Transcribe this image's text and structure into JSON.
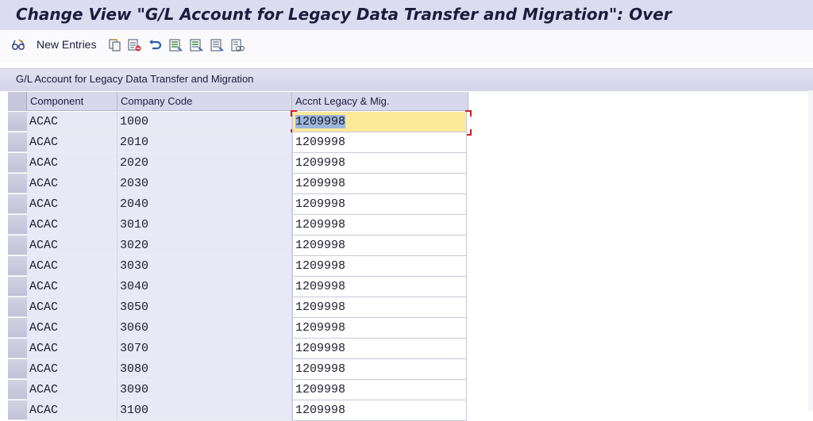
{
  "window": {
    "title": "Change View \"G/L Account for Legacy Data Transfer and Migration\": Over"
  },
  "toolbar": {
    "new_entries_label": "New Entries",
    "icons": [
      "glasses-icon",
      "copy-icon",
      "delete-icon",
      "undo-icon",
      "select-all-icon",
      "select-block-icon",
      "deselect-all-icon",
      "print-icon"
    ]
  },
  "panel": {
    "title": "G/L Account for Legacy Data Transfer and Migration",
    "columns": [
      "Component",
      "Company Code",
      "Accnt Legacy & Mig."
    ],
    "rows": [
      {
        "component": "ACAC",
        "company_code": "1000",
        "account": "1209998"
      },
      {
        "component": "ACAC",
        "company_code": "2010",
        "account": "1209998"
      },
      {
        "component": "ACAC",
        "company_code": "2020",
        "account": "1209998"
      },
      {
        "component": "ACAC",
        "company_code": "2030",
        "account": "1209998"
      },
      {
        "component": "ACAC",
        "company_code": "2040",
        "account": "1209998"
      },
      {
        "component": "ACAC",
        "company_code": "3010",
        "account": "1209998"
      },
      {
        "component": "ACAC",
        "company_code": "3020",
        "account": "1209998"
      },
      {
        "component": "ACAC",
        "company_code": "3030",
        "account": "1209998"
      },
      {
        "component": "ACAC",
        "company_code": "3040",
        "account": "1209998"
      },
      {
        "component": "ACAC",
        "company_code": "3050",
        "account": "1209998"
      },
      {
        "component": "ACAC",
        "company_code": "3060",
        "account": "1209998"
      },
      {
        "component": "ACAC",
        "company_code": "3070",
        "account": "1209998"
      },
      {
        "component": "ACAC",
        "company_code": "3080",
        "account": "1209998"
      },
      {
        "component": "ACAC",
        "company_code": "3090",
        "account": "1209998"
      },
      {
        "component": "ACAC",
        "company_code": "3100",
        "account": "1209998"
      }
    ]
  },
  "colors": {
    "title_bg": "#dcdcf0",
    "header_bg": "#d8d8ec",
    "focus_cell": "#fde99a",
    "selection": "#9cb6da"
  }
}
